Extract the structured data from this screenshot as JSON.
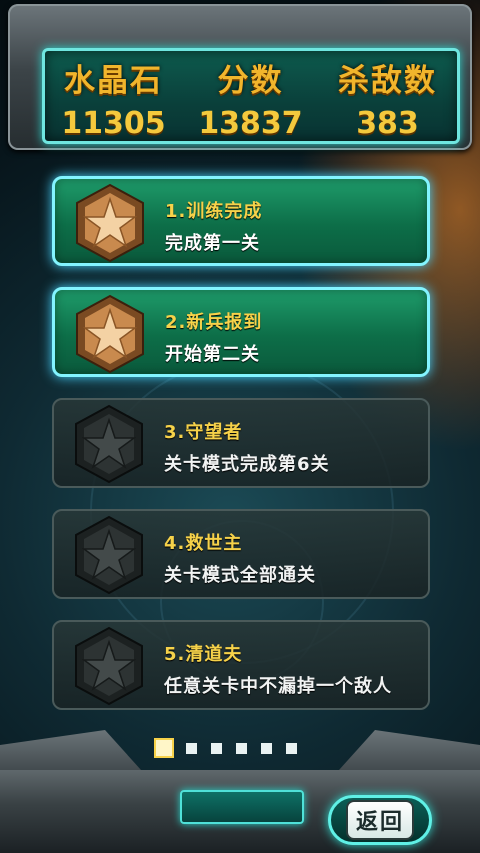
{
  "header": {
    "stats": [
      {
        "label": "水晶石",
        "value": "11305"
      },
      {
        "label": "分数",
        "value": "13837"
      },
      {
        "label": "杀敌数",
        "value": "383"
      }
    ]
  },
  "achievements": [
    {
      "title": "1.训练完成",
      "desc": "完成第一关",
      "unlocked": true,
      "icon": "bronze-star-badge-icon"
    },
    {
      "title": "2.新兵报到",
      "desc": "开始第二关",
      "unlocked": true,
      "icon": "bronze-star-badge-icon"
    },
    {
      "title": "3.守望者",
      "desc": "关卡模式完成第6关",
      "unlocked": false,
      "icon": "locked-star-badge-icon"
    },
    {
      "title": "4.救世主",
      "desc": "关卡模式全部通关",
      "unlocked": false,
      "icon": "locked-star-badge-icon"
    },
    {
      "title": "5.清道夫",
      "desc": "任意关卡中不漏掉一个敌人",
      "unlocked": false,
      "icon": "locked-star-badge-icon"
    }
  ],
  "pagination": {
    "total": 6,
    "current": 1
  },
  "back_button": {
    "label": "返回"
  },
  "colors": {
    "unlocked_card": "#0d6e48",
    "accent_cyan": "#83f4ff",
    "title_gold": "#f6d24a"
  }
}
